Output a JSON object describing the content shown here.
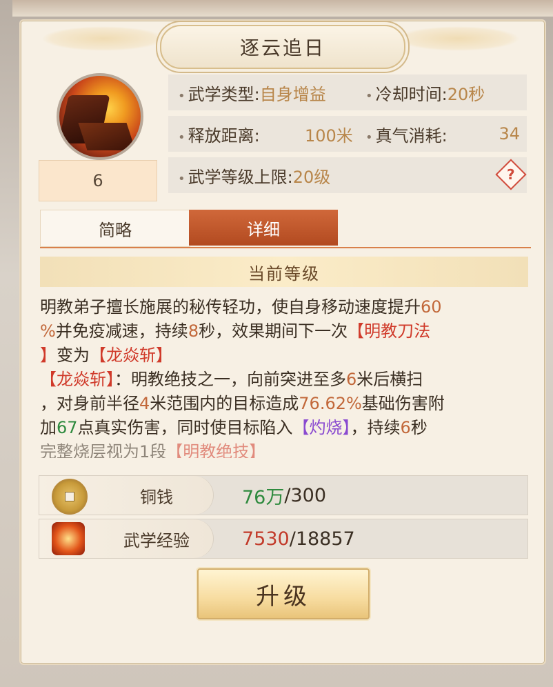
{
  "skill": {
    "title": "逐云追日",
    "level": "6",
    "icon": "skill-fire-rock-icon"
  },
  "info": {
    "type_label": "武学类型:",
    "type_value": "自身增益",
    "cooldown_label": "冷却时间:",
    "cooldown_value": "20秒",
    "range_label": "释放距离:",
    "range_value": "100米",
    "qi_label": "真气消耗:",
    "qi_value": "34",
    "maxlevel_label": "武学等级上限:",
    "maxlevel_value": "20级",
    "help_symbol": "?"
  },
  "tabs": {
    "simple": "简略",
    "detail": "详细",
    "active": "detail"
  },
  "section": {
    "current_level": "当前等级"
  },
  "description": {
    "l1a": "明教弟子擅长施展的秘传轻功，使自身移动速度提升",
    "l1b": "60",
    "l2a": "%",
    "l2b": "并免疫减速，持续",
    "l2c": "8",
    "l2d": "秒，效果期间下一次",
    "l2e": "【明教刀法",
    "l3a": "】",
    "l3b": "变为",
    "l3c": "【龙焱斩】",
    "l4a": "【龙焱斩】",
    "l4b": "：明教绝技之一，向前突进至多",
    "l4c": "6",
    "l4d": "米后横扫",
    "l5a": "，对身前半径",
    "l5b": "4",
    "l5c": "米范围内的目标造成",
    "l5d": "76.62%",
    "l5e": "基础伤害附",
    "l6a": "加",
    "l6b": "67",
    "l6c": "点真实伤害，同时使目标陷入",
    "l6d": "【灼烧】",
    "l6e": "，持续",
    "l6f": "6",
    "l6g": "秒",
    "l7a": "完整烧层视为1段",
    "l7b": "【明教绝技】"
  },
  "costs": {
    "copper_label": "铜钱",
    "copper_have": "76万",
    "copper_need": "/300",
    "copper_icon": "copper-coin-icon",
    "exp_label": "武学经验",
    "exp_have": "7530",
    "exp_need": "/18857",
    "exp_icon": "martial-exp-icon"
  },
  "buttons": {
    "upgrade": "升级"
  },
  "colors": {
    "accent_tab": "#c0582c",
    "highlight_red": "#d03a2a",
    "highlight_green": "#2e8a3e",
    "highlight_purple": "#8a4ad0",
    "value_gold": "#b8864a"
  }
}
